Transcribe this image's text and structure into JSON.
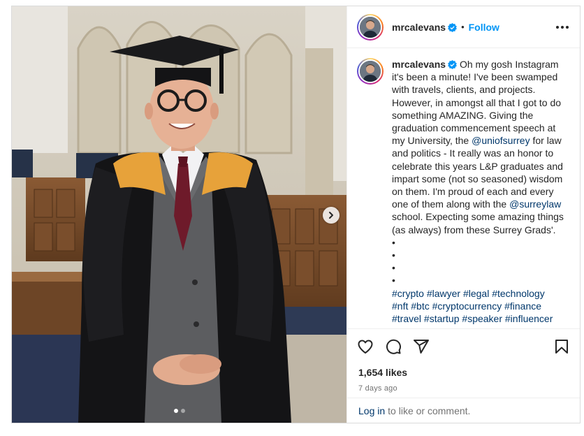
{
  "post": {
    "username": "mrcalevans",
    "follow_label": "Follow",
    "separator": "•",
    "caption": {
      "p1": "Oh my gosh Instagram it's been a minute! I've been swamped with travels, clients, and projects. However, in amongst all that I got to do something AMAZING. Giving the graduation commencement speech at my University, the ",
      "mention1": "@uniofsurrey",
      "p2": " for law and politics - It really was an honor to celebrate this years L&P graduates and impart some (not so seasoned) wisdom on them. I'm proud of each and every one of them along with the ",
      "mention2": "@surreylaw",
      "p3": " school. Expecting some amazing things (as always) from these Surrey Grads'.",
      "bullets": [
        "•",
        "•",
        "•",
        "•"
      ],
      "hashtags_line1": [
        "#crypto",
        "#lawyer",
        "#legal",
        "#technology"
      ],
      "hashtags_line2": [
        "#nft",
        "#btc",
        "#cryptocurrency",
        "#finance"
      ],
      "hashtags_line3": [
        "#travel",
        "#startup",
        "#speaker",
        "#influencer"
      ]
    },
    "likes": "1,654 likes",
    "posted": "7 days ago",
    "footer": {
      "login_label": "Log in",
      "suffix": "to like or comment."
    },
    "carousel": {
      "current": 1,
      "total": 2
    }
  },
  "icons": {
    "verified": "verified-badge-icon",
    "more": "more-options-icon",
    "like": "heart-icon",
    "comment": "comment-icon",
    "share": "share-icon",
    "save": "bookmark-icon",
    "next": "chevron-right-icon"
  },
  "colors": {
    "link_blue": "#0095f6",
    "hashtag": "#00376b",
    "muted": "#737373"
  }
}
